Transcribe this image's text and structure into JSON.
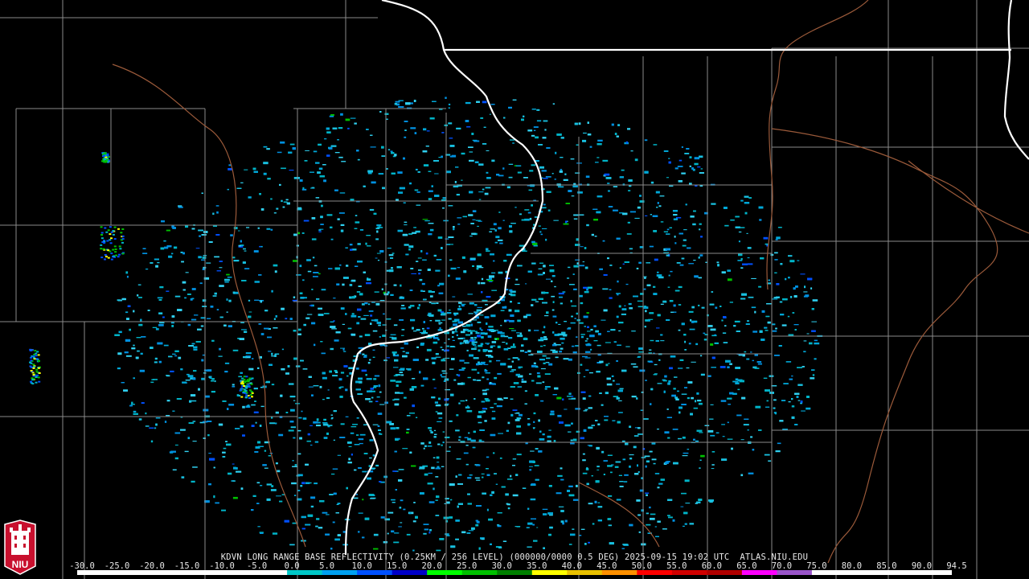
{
  "product": {
    "caption": "KDVN LONG RANGE BASE REFLECTIVITY (0.25KM / 256 LEVEL) (000000/0000 0.5 DEG) 2025-09-15 19:02 UTC  ATLAS.NIU.EDU"
  },
  "color_scale": {
    "labels": [
      "-30.0",
      "-25.0",
      "-20.0",
      "-15.0",
      "-10.0",
      "-5.0",
      "0.0",
      "5.0",
      "10.0",
      "15.0",
      "20.0",
      "25.0",
      "30.0",
      "35.0",
      "40.0",
      "45.0",
      "50.0",
      "55.0",
      "60.0",
      "65.0",
      "70.0",
      "75.0",
      "80.0",
      "85.0",
      "90.0",
      "94.5"
    ],
    "colors": [
      "#ffffff",
      "#ffffff",
      "#ffffff",
      "#ffffff",
      "#ffffff",
      "#ffffff",
      "#00c8c8",
      "#00a0f0",
      "#0050ff",
      "#0000c8",
      "#00ff00",
      "#00c000",
      "#008000",
      "#ffff00",
      "#e8c000",
      "#ff9000",
      "#ff0000",
      "#d00000",
      "#b00000",
      "#ff00ff",
      "#9955c9",
      "#ffffff",
      "#ffffff",
      "#ffffff",
      "#ffffff"
    ]
  },
  "logo": {
    "text": "NIU",
    "colors": {
      "shield": "#c8102e",
      "tower": "#ffffff",
      "outline": "#ffffff"
    }
  },
  "map": {
    "background": "#000000",
    "colors": {
      "county_lines": "#8a8a8a",
      "state_lines": "#ffffff",
      "river_lines": "#9b5a3a"
    }
  }
}
